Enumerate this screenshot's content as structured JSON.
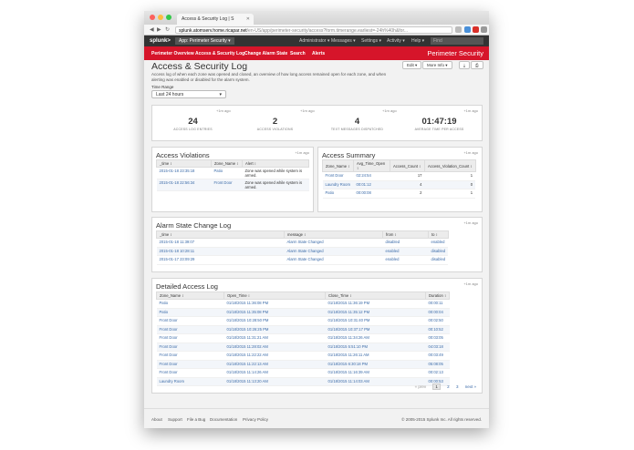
{
  "browser": {
    "tab_title": "Access & Security Log | S",
    "url_host": "splunk.atomserv.home.ricapar.net",
    "url_path": "/en-US/app/perimeter-security/access?form.timerange.earliest=-24h%40h&for..."
  },
  "splunk_bar": {
    "logo": "splunk>",
    "app_label": "App: Perimeter Security ▾",
    "menus": [
      "Administrator ▾",
      "Messages ▾",
      "Settings ▾",
      "Activity ▾",
      "Help ▾"
    ],
    "find_placeholder": "Find"
  },
  "app_nav": {
    "items": [
      "Perimeter Overview",
      "Access & Security Log",
      "Change Alarm State",
      "Search",
      "Alerts"
    ],
    "app_title": "Perimeter Security"
  },
  "page": {
    "title": "Access & Security Log",
    "description": "Access log of when each zone was opened and closed, an overview of how long access remained open for each zone, and when alerting was enabled or disabled for the alarm system.",
    "edit_label": "Edit ▾",
    "more_info_label": "More Info ▾",
    "time_range_label": "Time Range",
    "time_range_value": "Last 24 hours"
  },
  "summary": {
    "ago": "+1m ago",
    "singles": [
      {
        "value": "24",
        "label": "ACCESS LOG ENTRIES"
      },
      {
        "value": "2",
        "label": "ACCESS VIOLATIONS"
      },
      {
        "value": "4",
        "label": "TEXT MESSAGES DISPATCHED"
      },
      {
        "value": "01:47:19",
        "label": "AVERAGE TIME PER ACCESS"
      }
    ]
  },
  "violations": {
    "title": "Access Violations",
    "ago": "+1m ago",
    "columns": [
      "_time ↕",
      "Zone_Name ↕",
      "Alert ↕"
    ],
    "rows": [
      [
        "2015-01-18 23:35:18",
        "Patio",
        "Zone was opened while system is armed."
      ],
      [
        "2015-01-18 22:56:34",
        "Front Door",
        "Zone was opened while system is armed."
      ]
    ]
  },
  "access_summary": {
    "title": "Access Summary",
    "ago": "+1m ago",
    "columns": [
      "Zone_Name ↕",
      "Avg_Time_Open ↕",
      "Access_Count ↕",
      "Access_Violation_Count ↕"
    ],
    "rows": [
      [
        "Front Door",
        "02:24:54",
        "17",
        "1"
      ],
      [
        "Laundry Room",
        "00:01:12",
        "4",
        "0"
      ],
      [
        "Patio",
        "00:00:08",
        "2",
        "1"
      ]
    ]
  },
  "alarm_log": {
    "title": "Alarm State Change Log",
    "ago": "+1m ago",
    "columns": [
      "_time ↕",
      "message ↕",
      "from ↕",
      "to ↕"
    ],
    "rows": [
      [
        "2015-01-18 11:39:07",
        "Alarm State Changed",
        "disabled",
        "enabled"
      ],
      [
        "2015-01-18 10:28:11",
        "Alarm State Changed",
        "enabled",
        "disabled"
      ],
      [
        "2015-01-17 23:09:29",
        "Alarm State Changed",
        "enabled",
        "disabled"
      ]
    ]
  },
  "detailed_log": {
    "title": "Detailed Access Log",
    "ago": "+1m ago",
    "columns": [
      "Zone_Name ↕",
      "Open_Time ↕",
      "Close_Time ↕",
      "Duration ↕"
    ],
    "rows": [
      [
        "Patio",
        "01/18/2015 11:36:08 PM",
        "01/18/2015 11:36:19 PM",
        "00:00:11"
      ],
      [
        "Patio",
        "01/18/2015 11:35:08 PM",
        "01/18/2015 11:35:12 PM",
        "00:00:04"
      ],
      [
        "Front Door",
        "01/18/2015 10:28:50 PM",
        "01/18/2015 10:31:40 PM",
        "00:02:50"
      ],
      [
        "Front Door",
        "01/18/2015 10:26:25 PM",
        "01/18/2015 10:37:17 PM",
        "00:10:52"
      ],
      [
        "Front Door",
        "01/18/2015 11:31:21 AM",
        "01/18/2015 11:34:26 AM",
        "00:03:05"
      ],
      [
        "Front Door",
        "01/18/2015 11:28:02 AM",
        "01/18/2015 5:51:10 PM",
        "04:03:18"
      ],
      [
        "Front Door",
        "01/18/2015 11:22:22 AM",
        "01/18/2015 11:26:11 AM",
        "00:03:49"
      ],
      [
        "Front Door",
        "01/18/2015 11:22:13 AM",
        "01/18/2015 6:30:18 PM",
        "05:08:05"
      ],
      [
        "Front Door",
        "01/18/2015 11:14:26 AM",
        "01/18/2015 11:16:39 AM",
        "00:02:13"
      ],
      [
        "Laundry Room",
        "01/18/2015 11:13:20 AM",
        "01/18/2015 11:14:03 AM",
        "00:00:53"
      ]
    ],
    "pager": {
      "prev": "« prev",
      "pages": [
        "1",
        "2",
        "3"
      ],
      "next": "next »"
    }
  },
  "footer": {
    "links": [
      "About",
      "Support",
      "File a Bug",
      "Documentation",
      "Privacy Policy"
    ],
    "copyright": "© 2005-2015 Splunk Inc. All rights reserved."
  },
  "colors": {
    "splunk_red": "#d6152a",
    "link_blue": "#3a6aa8"
  }
}
